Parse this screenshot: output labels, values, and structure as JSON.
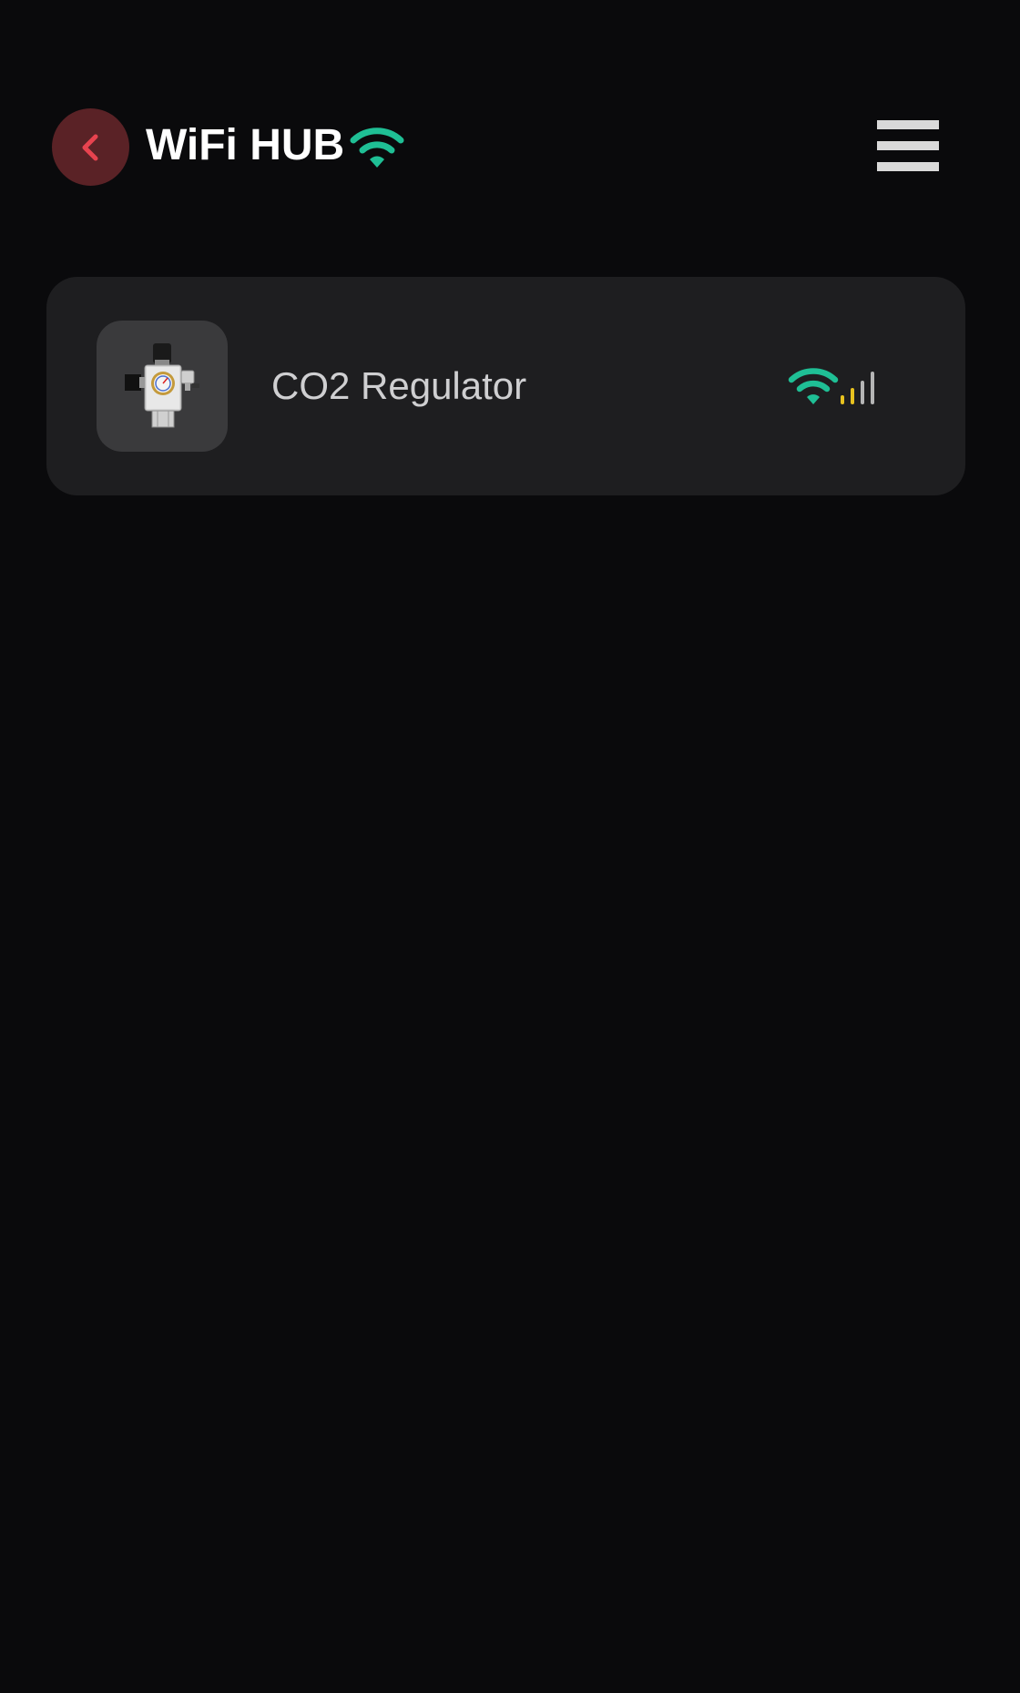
{
  "header": {
    "title": "WiFi HUB",
    "back_icon": "chevron-left-icon",
    "status_icon": "wifi-icon",
    "menu_icon": "hamburger-menu-icon"
  },
  "devices": [
    {
      "name": "CO2 Regulator",
      "thumbnail_icon": "co2-regulator-icon",
      "wifi_icon": "wifi-icon",
      "signal_icon": "signal-strength-icon",
      "signal_level": 0.5
    }
  ],
  "colors": {
    "background": "#0a0a0c",
    "card": "#1e1e20",
    "accent_green": "#1fbf95",
    "back_button_bg": "#5a2226",
    "back_chevron": "#e8434f",
    "signal_active": "#e8c21f",
    "signal_inactive": "#b5b5b5"
  }
}
